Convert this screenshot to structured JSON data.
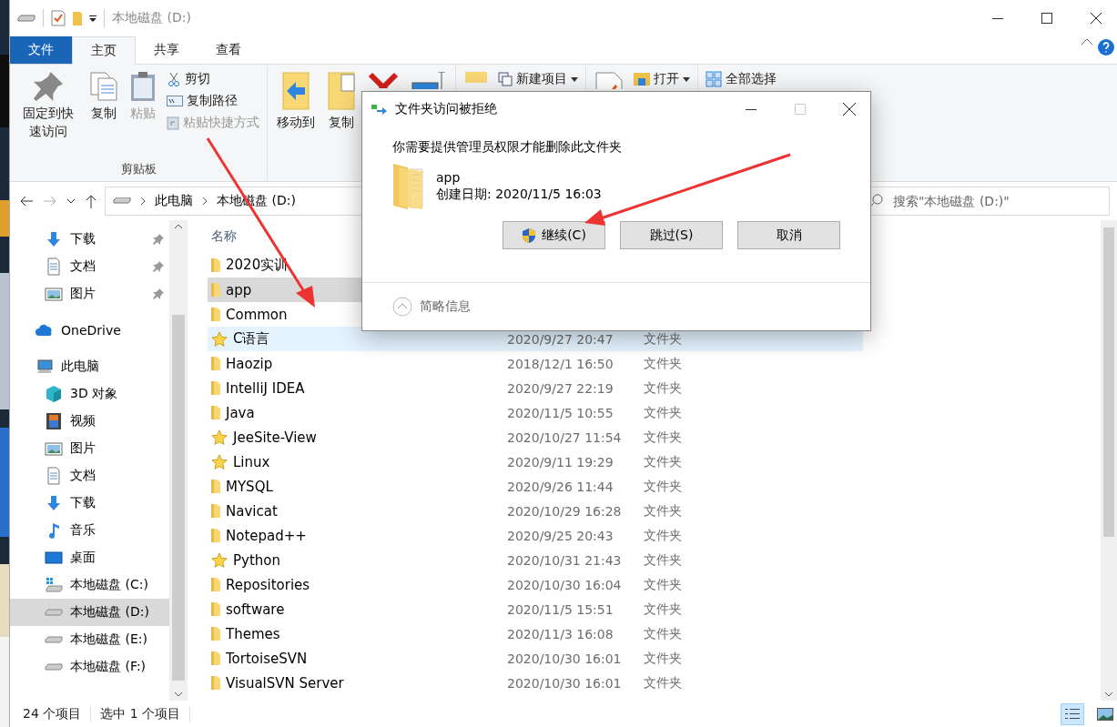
{
  "window": {
    "title": "本地磁盘 (D:)"
  },
  "ribbon_tabs": [
    {
      "label": "文件",
      "kind": "file",
      "selected": false
    },
    {
      "label": "主页",
      "kind": "tab",
      "selected": true
    },
    {
      "label": "共享",
      "kind": "tab",
      "selected": false
    },
    {
      "label": "查看",
      "kind": "tab",
      "selected": false
    }
  ],
  "ribbon": {
    "clipboard": {
      "pin": "固定到快速访问",
      "copy": "复制",
      "paste": "粘贴",
      "cut": "剪切",
      "copy_path": "复制路径",
      "paste_shortcut": "粘贴快捷方式",
      "paste_disabled": true,
      "group": "剪贴板"
    },
    "organize": {
      "move_to": "移动到",
      "copy_to": "复制"
    },
    "new_item": "新建项目",
    "open": "打开",
    "select_all": "全部选择"
  },
  "address": {
    "crumbs": [
      "此电脑",
      "本地磁盘 (D:)"
    ],
    "search_placeholder": "搜索\"本地磁盘 (D:)\""
  },
  "nav": {
    "quick_access": [
      {
        "label": "下载",
        "kind": "download",
        "pinned": true,
        "selected": false
      },
      {
        "label": "文档",
        "kind": "doc",
        "pinned": true,
        "selected": false
      },
      {
        "label": "图片",
        "kind": "picture",
        "pinned": true,
        "selected": false
      }
    ],
    "tree": [
      {
        "label": "OneDrive",
        "kind": "cloud",
        "selected": false
      },
      {
        "label": "此电脑",
        "kind": "pc",
        "selected": false,
        "children": [
          {
            "label": "3D 对象",
            "kind": "cube",
            "selected": false
          },
          {
            "label": "视频",
            "kind": "video",
            "selected": false
          },
          {
            "label": "图片",
            "kind": "picture",
            "selected": false
          },
          {
            "label": "文档",
            "kind": "doc",
            "selected": false
          },
          {
            "label": "下载",
            "kind": "download",
            "selected": false
          },
          {
            "label": "音乐",
            "kind": "music",
            "selected": false
          },
          {
            "label": "桌面",
            "kind": "desktop",
            "selected": false
          },
          {
            "label": "本地磁盘 (C:)",
            "kind": "sysdrive",
            "selected": false
          },
          {
            "label": "本地磁盘 (D:)",
            "kind": "drive",
            "selected": true
          },
          {
            "label": "本地磁盘 (E:)",
            "kind": "drive",
            "selected": false
          },
          {
            "label": "本地磁盘 (F:)",
            "kind": "drive",
            "selected": false
          }
        ]
      }
    ]
  },
  "files": {
    "column": "名称",
    "rows": [
      {
        "name": "2020实训",
        "starred": false,
        "selected": false,
        "hovered": false
      },
      {
        "name": "app",
        "starred": false,
        "selected": true,
        "hovered": false
      },
      {
        "name": "Common",
        "starred": false,
        "selected": false,
        "hovered": false
      },
      {
        "name": "C语言",
        "starred": true,
        "selected": false,
        "hovered": true,
        "date": "2020/9/27 20:47",
        "type": "文件夹"
      },
      {
        "name": "Haozip",
        "starred": false,
        "selected": false,
        "hovered": false,
        "date": "2018/12/1 16:50",
        "type": "文件夹"
      },
      {
        "name": "IntelliJ IDEA",
        "starred": false,
        "selected": false,
        "hovered": false,
        "date": "2020/9/27 22:19",
        "type": "文件夹"
      },
      {
        "name": "Java",
        "starred": false,
        "selected": false,
        "hovered": false,
        "date": "2020/11/5 10:55",
        "type": "文件夹"
      },
      {
        "name": "JeeSite-View",
        "starred": true,
        "selected": false,
        "hovered": false,
        "date": "2020/10/27 11:54",
        "type": "文件夹"
      },
      {
        "name": "Linux",
        "starred": true,
        "selected": false,
        "hovered": false,
        "date": "2020/9/11 19:29",
        "type": "文件夹"
      },
      {
        "name": "MYSQL",
        "starred": false,
        "selected": false,
        "hovered": false,
        "date": "2020/9/26 11:44",
        "type": "文件夹"
      },
      {
        "name": "Navicat",
        "starred": false,
        "selected": false,
        "hovered": false,
        "date": "2020/10/29 16:28",
        "type": "文件夹"
      },
      {
        "name": "Notepad++",
        "starred": false,
        "selected": false,
        "hovered": false,
        "date": "2020/9/25 20:43",
        "type": "文件夹"
      },
      {
        "name": "Python",
        "starred": true,
        "selected": false,
        "hovered": false,
        "date": "2020/10/31 21:43",
        "type": "文件夹"
      },
      {
        "name": "Repositories",
        "starred": false,
        "selected": false,
        "hovered": false,
        "date": "2020/10/30 16:04",
        "type": "文件夹"
      },
      {
        "name": "software",
        "starred": false,
        "selected": false,
        "hovered": false,
        "date": "2020/11/5 15:51",
        "type": "文件夹"
      },
      {
        "name": "Themes",
        "starred": false,
        "selected": false,
        "hovered": false,
        "date": "2020/11/3 16:08",
        "type": "文件夹"
      },
      {
        "name": "TortoiseSVN",
        "starred": false,
        "selected": false,
        "hovered": false,
        "date": "2020/10/30 16:01",
        "type": "文件夹"
      },
      {
        "name": "VisualSVN Server",
        "starred": false,
        "selected": false,
        "hovered": false,
        "date": "2020/10/30 16:01",
        "type": "文件夹"
      }
    ]
  },
  "status_bar": {
    "count": "24 个项目",
    "selection": "选中 1 个项目"
  },
  "views": [
    {
      "kind": "details",
      "selected": true
    },
    {
      "kind": "thumbs",
      "selected": false
    }
  ],
  "dialog": {
    "title": "文件夹访问被拒绝",
    "message": "你需要提供管理员权限才能删除此文件夹",
    "item_name": "app",
    "item_date": "创建日期: 2020/11/5 16:03",
    "buttons": [
      {
        "label": "继续(C)",
        "kind": "shield"
      },
      {
        "label": "跳过(S)",
        "kind": "plain"
      },
      {
        "label": "取消",
        "kind": "plain"
      }
    ],
    "details": "简略信息",
    "details_expanded": false
  }
}
